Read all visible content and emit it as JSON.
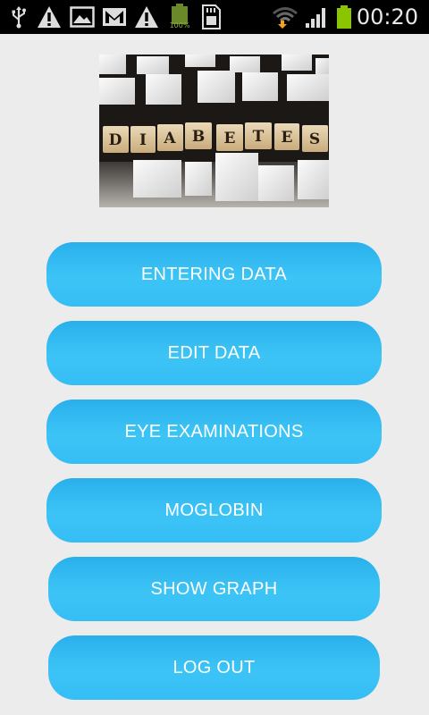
{
  "status_bar": {
    "time": "00:20",
    "battery_small_label": "100%",
    "icons": [
      "usb-icon",
      "warning-icon",
      "gallery-icon",
      "gmail-icon",
      "warning-icon",
      "battery-small-icon",
      "sd-card-icon",
      "wifi-icon",
      "signal-icon",
      "battery-icon"
    ],
    "battery_color": "#8bc400"
  },
  "banner": {
    "letters": [
      "D",
      "I",
      "A",
      "B",
      "E",
      "T",
      "E",
      "S"
    ]
  },
  "menu": {
    "entering_data": "ENTERING DATA",
    "edit_data": "EDIT DATA",
    "eye_examinations": "EYE EXAMINATIONS",
    "moglobin": "MOGLOBIN",
    "show_graph": "SHOW GRAPH",
    "log_out": "LOG OUT"
  },
  "colors": {
    "button": "#35bef5",
    "background": "#ececec"
  }
}
